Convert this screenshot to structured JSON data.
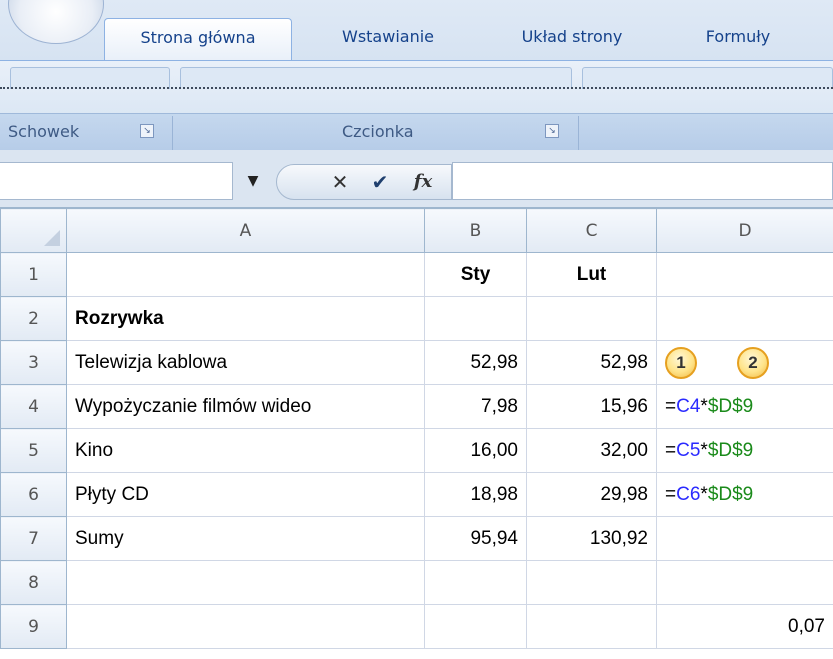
{
  "ribbon": {
    "tabs": [
      {
        "label": "Strona główna",
        "active": true
      },
      {
        "label": "Wstawianie",
        "active": false
      },
      {
        "label": "Układ strony",
        "active": false
      },
      {
        "label": "Formuły",
        "active": false
      }
    ],
    "groups": [
      {
        "label": "Schowek"
      },
      {
        "label": "Czcionka"
      }
    ]
  },
  "formula_bar": {
    "name_box_value": "",
    "cancel_symbol": "✕",
    "enter_symbol": "✔",
    "fx_symbol": "fx",
    "formula_value": ""
  },
  "sheet": {
    "columns": [
      "A",
      "B",
      "C",
      "D"
    ],
    "rows": [
      {
        "num": "1",
        "a": "",
        "b": "Sty",
        "c": "Lut",
        "d": ""
      },
      {
        "num": "2",
        "a": "Rozrywka",
        "b": "",
        "c": "",
        "d": ""
      },
      {
        "num": "3",
        "a": "Telewizja kablowa",
        "b": "52,98",
        "c": "52,98",
        "d_callouts": [
          "1",
          "2"
        ]
      },
      {
        "num": "4",
        "a": "Wypożyczanie filmów wideo",
        "b": "7,98",
        "c": "15,96",
        "d_formula": {
          "eq": "=",
          "ref": "C4",
          "op": "*",
          "abs": "$D$9"
        }
      },
      {
        "num": "5",
        "a": "Kino",
        "b": "16,00",
        "c": "32,00",
        "d_formula": {
          "eq": "=",
          "ref": "C5",
          "op": "*",
          "abs": "$D$9"
        }
      },
      {
        "num": "6",
        "a": "Płyty CD",
        "b": "18,98",
        "c": "29,98",
        "d_formula": {
          "eq": "=",
          "ref": "C6",
          "op": "*",
          "abs": "$D$9"
        }
      },
      {
        "num": "7",
        "a": "Sumy",
        "b": "95,94",
        "c": "130,92",
        "d": ""
      },
      {
        "num": "8",
        "a": "",
        "b": "",
        "c": "",
        "d": ""
      },
      {
        "num": "9",
        "a": "",
        "b": "",
        "c": "",
        "d": "0,07"
      }
    ]
  },
  "colors": {
    "relative_ref": "#2a2aff",
    "absolute_ref": "#1a8a1a",
    "callout_fill": "#ffe48a"
  }
}
